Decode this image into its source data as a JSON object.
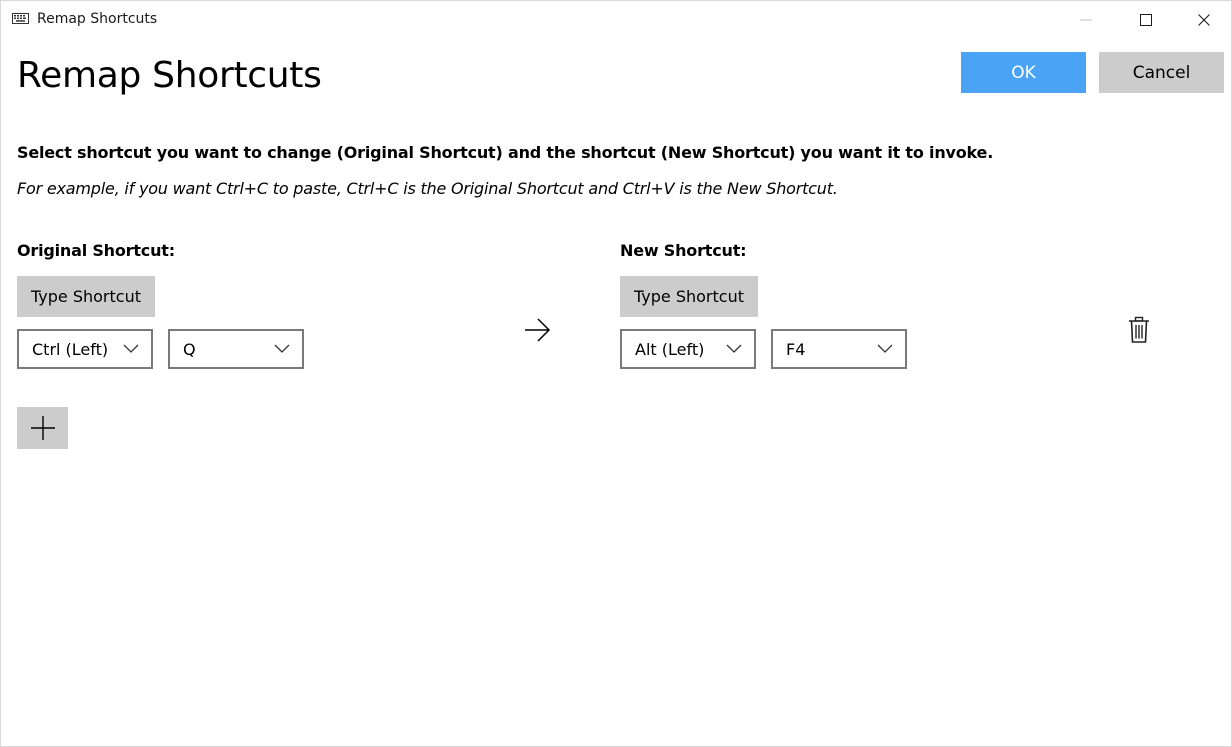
{
  "window": {
    "title": "Remap Shortcuts",
    "icon": "keyboard-icon"
  },
  "header": {
    "title": "Remap Shortcuts",
    "ok_label": "OK",
    "cancel_label": "Cancel"
  },
  "instructions": {
    "main": "Select shortcut you want to change (Original Shortcut) and the shortcut (New Shortcut) you want it to invoke.",
    "example": "For example, if you want Ctrl+C to paste, Ctrl+C is the Original Shortcut and Ctrl+V is the New Shortcut."
  },
  "columns": {
    "original_heading": "Original Shortcut:",
    "new_heading": "New Shortcut:"
  },
  "rows": [
    {
      "original": {
        "type_label": "Type Shortcut",
        "modifier": "Ctrl (Left)",
        "key": "Q"
      },
      "new": {
        "type_label": "Type Shortcut",
        "modifier": "Alt (Left)",
        "key": "F4"
      }
    }
  ],
  "colors": {
    "accent": "#4aa3f5",
    "button_gray": "#cccccc",
    "border_gray": "#7a7a7a"
  }
}
